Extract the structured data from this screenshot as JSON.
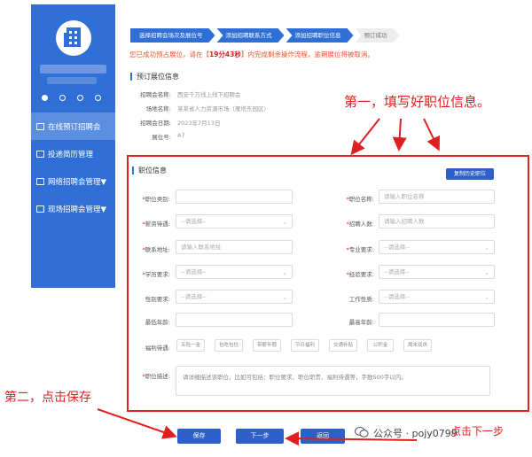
{
  "sidebar": {
    "items": [
      {
        "label": "在线预订招聘会",
        "active": true
      },
      {
        "label": "投递简历管理",
        "active": false
      },
      {
        "label": "网络招聘会管理▼",
        "active": false
      },
      {
        "label": "现场招聘会管理▼",
        "active": false
      }
    ]
  },
  "steps": [
    {
      "label": "选择招聘会场次及展位号",
      "active": true
    },
    {
      "label": "添加招聘联系方式",
      "active": true
    },
    {
      "label": "添加招聘职位信息",
      "active": true
    },
    {
      "label": "预订成功",
      "active": false
    }
  ],
  "notice": {
    "prefix": "您已成功预占展位，请在【",
    "highlight": "19分43秒",
    "suffix": "】内完成剩余操作流程，逾期展位将被取消。"
  },
  "booking_info": {
    "title": "预订展位信息",
    "rows": [
      {
        "key": "招聘会名称:",
        "value": "西安千万线上线下招聘会"
      },
      {
        "key": "场地名称:",
        "value": "某某省人力资源市场（雁塔东园区）"
      },
      {
        "key": "招聘会日期:",
        "value": "2023年7月13日"
      },
      {
        "key": "展位号:",
        "value": "A7"
      }
    ]
  },
  "position_form": {
    "title": "职位信息",
    "import_button": "复制历史职位",
    "fields": [
      {
        "label": "职位类别:",
        "required": true,
        "value": ""
      },
      {
        "label": "职位名称:",
        "required": true,
        "value": "请输入职位名称"
      },
      {
        "label": "薪资待遇:",
        "required": true,
        "value": "--请选择--"
      },
      {
        "label": "招聘人数:",
        "required": true,
        "value": "请输入招聘人数"
      },
      {
        "label": "联系地址:",
        "required": true,
        "value": "请输入联系地址"
      },
      {
        "label": "专业要求:",
        "required": true,
        "value": "--请选择--"
      },
      {
        "label": "学历要求:",
        "required": true,
        "value": "--请选择--"
      },
      {
        "label": "经验要求:",
        "required": true,
        "value": "--请选择--"
      },
      {
        "label": "性别要求:",
        "required": false,
        "value": "--请选择--"
      },
      {
        "label": "工作性质:",
        "required": false,
        "value": "--请选择--"
      },
      {
        "label": "最低年龄:",
        "required": false,
        "value": ""
      },
      {
        "label": "最高年龄:",
        "required": false,
        "value": ""
      }
    ],
    "benefits_label": "福利待遇:",
    "benefits": [
      "五险一金",
      "包吃包住",
      "带薪年假",
      "节日福利",
      "交通补贴",
      "公积金",
      "周末双休"
    ],
    "description_label": "职位描述:",
    "description_placeholder": "请详细描述该职位，比如可包括：职位要求、职位职责、福利待遇等，字数500字以内。"
  },
  "buttons": {
    "save": "保存",
    "next": "下一步",
    "back": "返回"
  },
  "annotations": {
    "first": "第一，填写好职位信息。",
    "second": "第二，点击保存",
    "third": "点击下一步"
  },
  "watermark": {
    "text": "公众号 · pojy0799"
  }
}
